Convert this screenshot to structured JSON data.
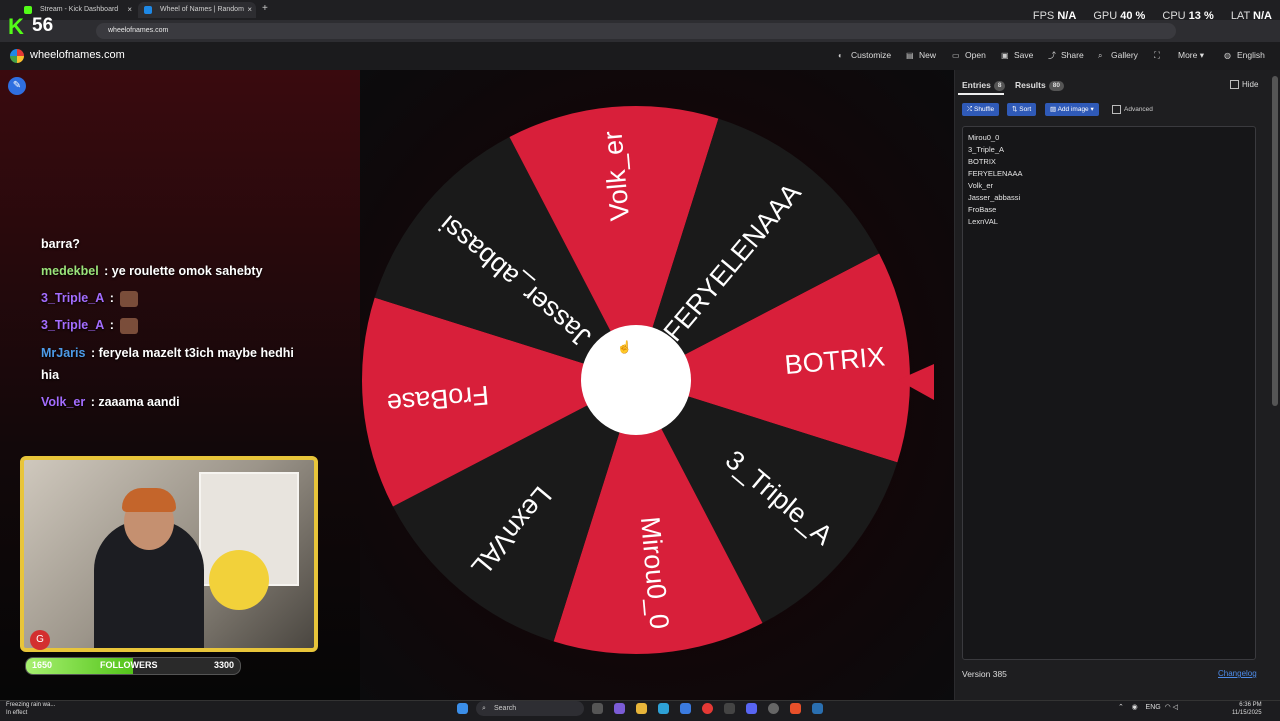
{
  "browser": {
    "tabs": [
      {
        "label": "Stream - Kick Dashboard",
        "close": "×"
      },
      {
        "label": "Wheel of Names | Random",
        "close": "×"
      }
    ],
    "new_tab": "+",
    "address": "wheelofnames.com"
  },
  "overlay": {
    "kick_logo": "K",
    "kick_number": "56",
    "perf": {
      "fps_label": "FPS",
      "fps": "N/A",
      "gpu_label": "GPU",
      "gpu": "40 %",
      "cpu_label": "CPU",
      "cpu": "13 %",
      "lat_label": "LAT",
      "lat": "N/A"
    }
  },
  "app": {
    "site_name": "wheelofnames.com",
    "menu": {
      "customize": "Customize",
      "new": "New",
      "open": "Open",
      "save": "Save",
      "share": "Share",
      "gallery": "Gallery",
      "more": "More",
      "language": "English"
    }
  },
  "chat": [
    {
      "user": "barra?",
      "color": "#ffffff",
      "text": ""
    },
    {
      "user": "medekbel",
      "color": "#9be37a",
      "text": ": ye roulette omok sahebty"
    },
    {
      "user": "3_Triple_A",
      "color": "#a46dff",
      "text": ":",
      "emote": true
    },
    {
      "user": "3_Triple_A",
      "color": "#a46dff",
      "text": ":",
      "emote": true
    },
    {
      "user": "MrJaris",
      "color": "#4d9be8",
      "text": ": feryela mazelt t3ich maybe hedhi"
    },
    {
      "user": "hia",
      "color": "#ffffff",
      "text": ""
    },
    {
      "user": "Volk_er",
      "color": "#a46dff",
      "text": ": zaaama aandi"
    }
  ],
  "followers": {
    "current": "1650",
    "label": "FOLLOWERS",
    "goal": "3300",
    "progress": 0.5
  },
  "wheel": {
    "segments": [
      "BOTRIX",
      "3_Triple_A",
      "Mirou0_0",
      "LexnVAL",
      "FroBase",
      "Jasser_abbassi",
      "Volk_er",
      "FERYELENAAA"
    ],
    "colors": [
      "#d81f3a",
      "#1a1a1a"
    ],
    "rotation_deg": -5
  },
  "panel": {
    "tab_entries": "Entries",
    "entries_count": "8",
    "tab_results": "Results",
    "results_count": "80",
    "hide": "Hide",
    "shuffle": "Shuffle",
    "sort": "Sort",
    "add_image": "Add image",
    "advanced": "Advanced",
    "entries": [
      "Mirou0_0",
      "3_Triple_A",
      "BOTRIX",
      "FERYELENAAA",
      "Volk_er",
      "Jasser_abbassi",
      "FroBase",
      "LexnVAL"
    ],
    "version": "Version 385",
    "changelog": "Changelog"
  },
  "taskbar": {
    "weather_line1": "Freezing rain wa...",
    "weather_line2": "In effect",
    "search": "Search",
    "lang": "ENG",
    "time": "6:36 PM",
    "date": "11/15/2025"
  }
}
